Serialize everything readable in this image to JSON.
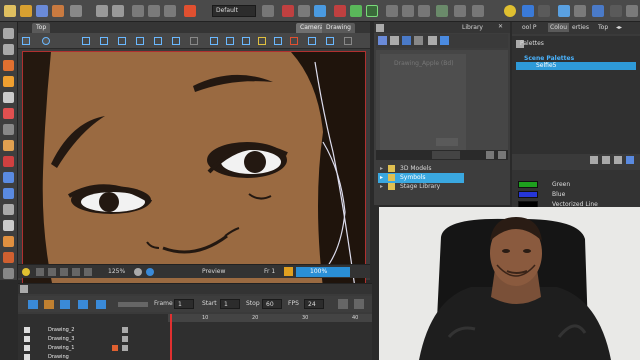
{
  "toolbar": {
    "workspace_select": "Default"
  },
  "view": {
    "tabs": [
      "Top",
      "Camera",
      "Drawing"
    ],
    "zoom": "125%",
    "mode": "Preview",
    "frame_label": "Fr 1",
    "opacity": "100%"
  },
  "library": {
    "tabs": [
      "Library"
    ],
    "template_title": "Drawing_Apple (Bd)",
    "items": [
      "3D Models",
      "Symbols",
      "Stage Library"
    ]
  },
  "palettes": {
    "tabs": [
      "ool P",
      "Colou",
      "erties",
      "Top"
    ],
    "title": "Palettes",
    "scene_header": "Scene Palettes",
    "selected_palette": "Selfie5",
    "colors": [
      {
        "name": "Green",
        "hex": "#1ea01e"
      },
      {
        "name": "Blue",
        "hex": "#2636d8"
      },
      {
        "name": "Vectorized Line",
        "hex": "#000000"
      }
    ]
  },
  "timeline": {
    "frame_label": "Frame",
    "frame_value": "1",
    "start_label": "Start",
    "start_value": "1",
    "stop_label": "Stop",
    "stop_value": "60",
    "fps_label": "FPS",
    "fps_value": "24",
    "ruler": [
      "10",
      "20",
      "30",
      "40"
    ],
    "layers": [
      "Drawing_2",
      "Drawing_3",
      "Drawing_1",
      "Drawing"
    ]
  },
  "colors": {
    "accent_blue": "#2e8fd6",
    "selection": "#3aa8e0",
    "skin": "#9a6a41"
  }
}
